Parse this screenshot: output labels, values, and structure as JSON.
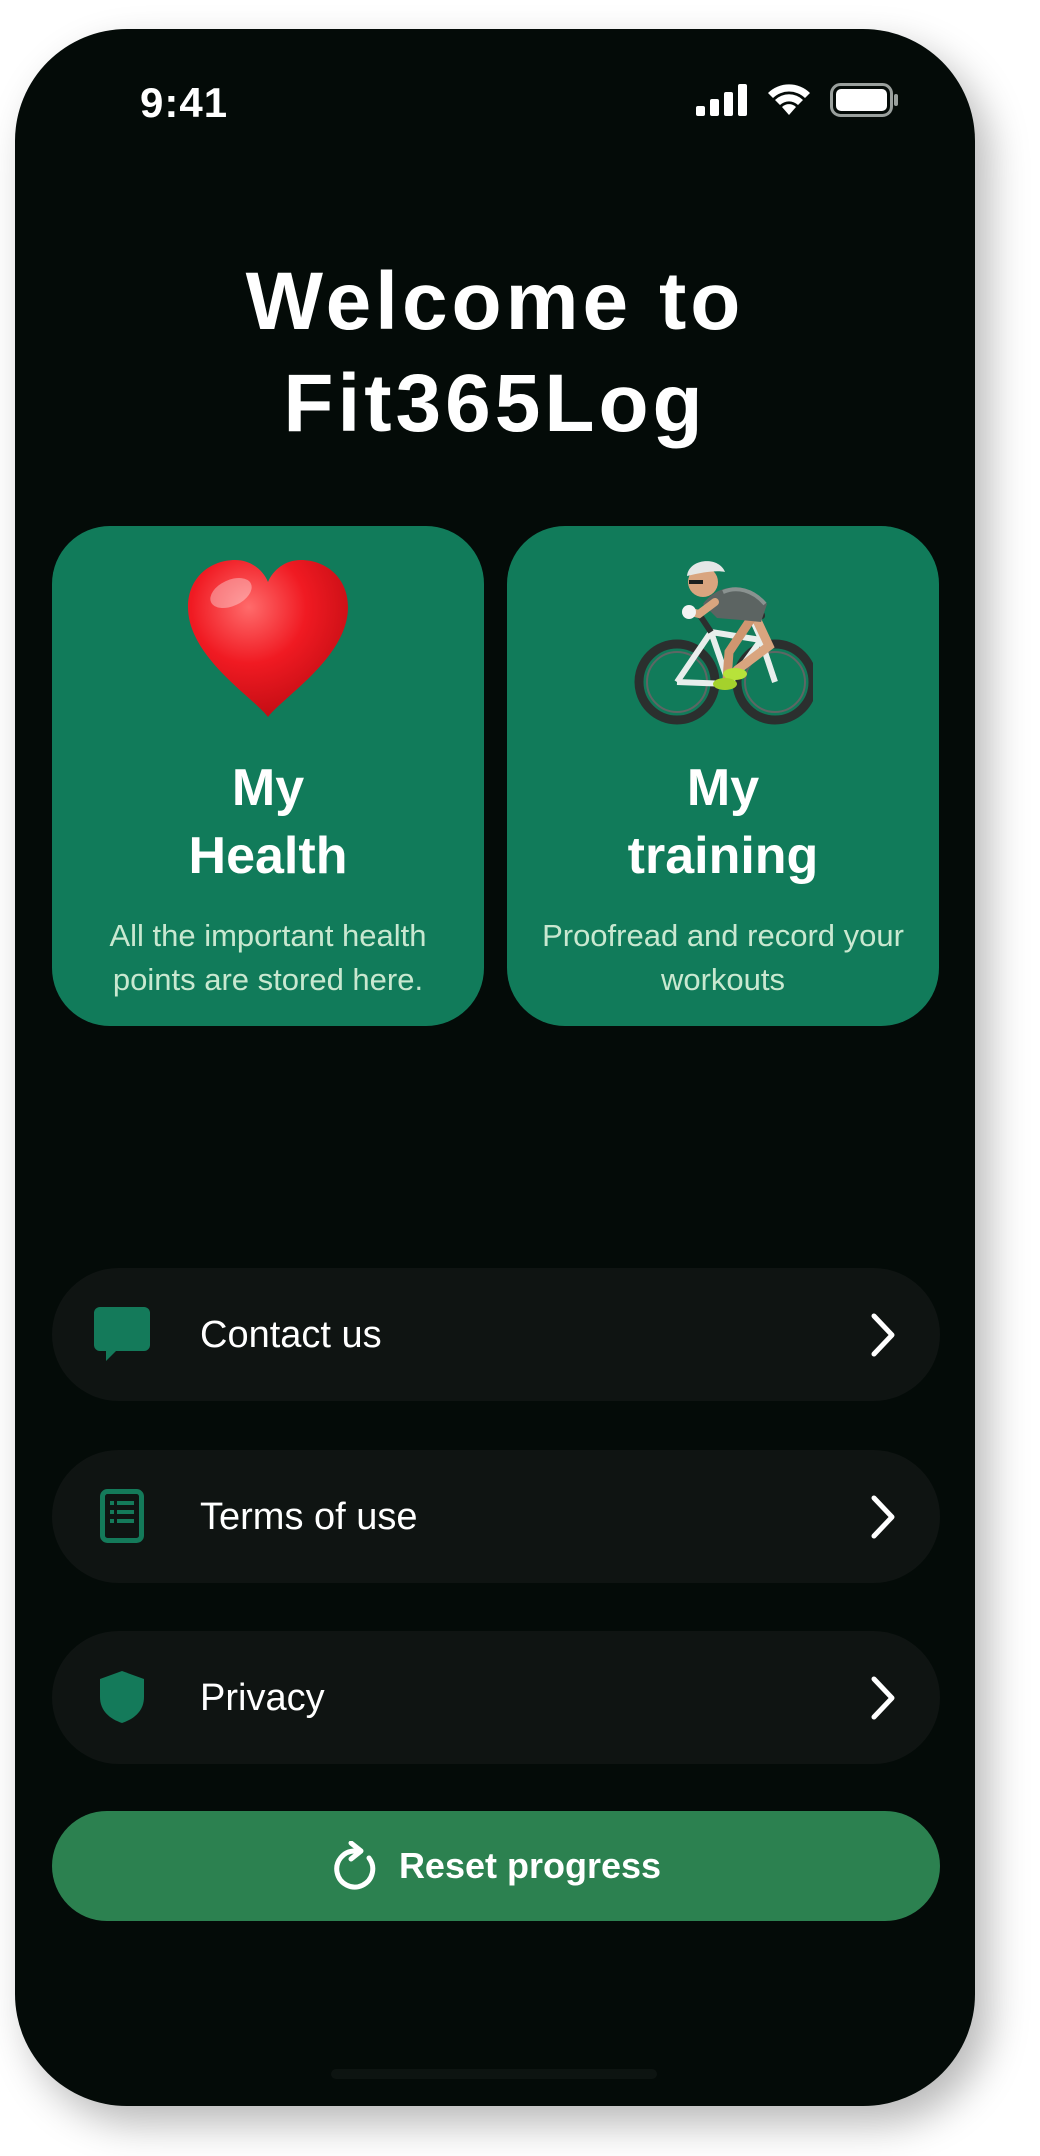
{
  "status_bar": {
    "time": "9:41"
  },
  "header": {
    "title_line1": "Welcome to",
    "title_line2": "Fit365Log"
  },
  "cards": [
    {
      "emoji": "❤️",
      "icon": "heart-icon",
      "title_line1": "My",
      "title_line2": "Health",
      "description": "All the important health points are stored here."
    },
    {
      "emoji": "🚴",
      "icon": "cyclist-icon",
      "title_line1": "My",
      "title_line2": "training",
      "description": "Proofread and record your workouts"
    }
  ],
  "menu": {
    "items": [
      {
        "label": "Contact us",
        "icon": "chat-bubble-icon"
      },
      {
        "label": "Terms of use",
        "icon": "document-list-icon"
      },
      {
        "label": "Privacy",
        "icon": "shield-icon"
      }
    ]
  },
  "reset": {
    "label": "Reset progress",
    "icon": "refresh-icon"
  },
  "colors": {
    "background": "#040b08",
    "card": "#117b5a",
    "menu_item": "#0f1412",
    "accent_icon": "#147a5a",
    "button": "#2c8150",
    "card_text_secondary": "#c9e8d0"
  }
}
